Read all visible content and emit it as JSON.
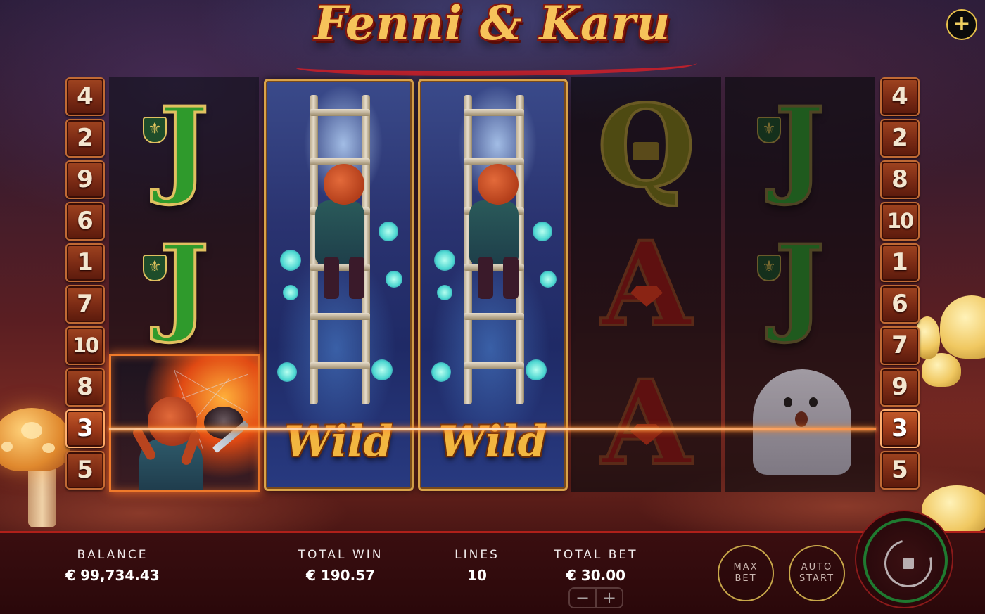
{
  "game": {
    "title": "Fenni & Karu"
  },
  "menu_button": {
    "label": "+"
  },
  "paylines": {
    "left": [
      "4",
      "2",
      "9",
      "6",
      "1",
      "7",
      "10",
      "8",
      "3",
      "5"
    ],
    "right": [
      "4",
      "2",
      "8",
      "10",
      "1",
      "6",
      "7",
      "9",
      "3",
      "5"
    ],
    "active_line": "3"
  },
  "reels": {
    "columns": [
      [
        "J",
        "J",
        "scatter-character"
      ],
      [
        "wild",
        "wild",
        "wild"
      ],
      [
        "wild",
        "wild",
        "wild"
      ],
      [
        "Q",
        "A",
        "A"
      ],
      [
        "J",
        "J",
        "ghost"
      ]
    ],
    "wild_label_1": "Wild",
    "wild_label_2": "Wild",
    "symbol_j": "J",
    "symbol_q": "Q",
    "symbol_a": "A"
  },
  "status": {
    "balance_label": "BALANCE",
    "balance_value": "€ 99,734.43",
    "total_win_label": "TOTAL WIN",
    "total_win_value": "€ 190.57",
    "lines_label": "LINES",
    "lines_value": "10",
    "total_bet_label": "TOTAL BET",
    "total_bet_value": "€ 30.00"
  },
  "controls": {
    "bet_decrease": "−",
    "bet_increase": "+",
    "max_bet_line1": "MAX",
    "max_bet_line2": "BET",
    "auto_start_line1": "AUTO",
    "auto_start_line2": "START"
  },
  "colors": {
    "accent_gold": "#c9a84a",
    "spin_ring": "#1f7a30",
    "bar_border": "#b0201a",
    "win_line": "#ff7a1a"
  },
  "icons": {
    "menu": "plus-icon",
    "spin": "spin-icon",
    "j_suit": "fleur-de-lis-icon",
    "q_suit": "crown-icon",
    "a_suit": "gem-icon"
  }
}
